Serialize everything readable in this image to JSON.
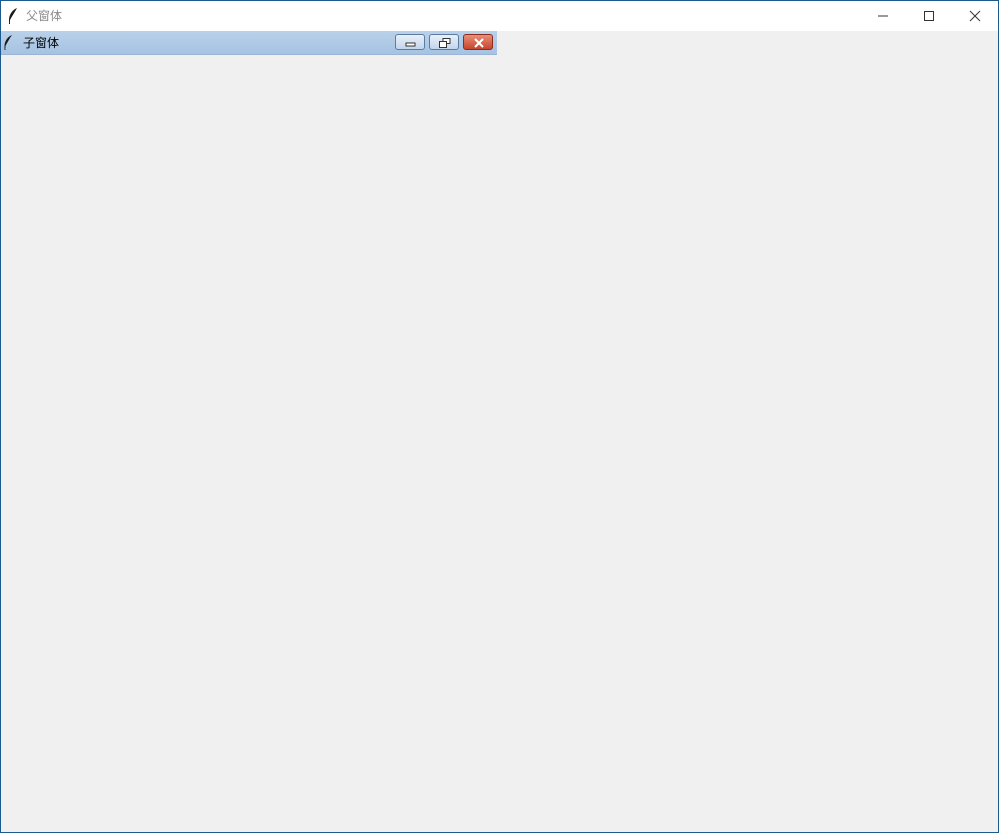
{
  "window": {
    "title": "父窗体",
    "icon": "feather-icon",
    "controls": [
      "minimize",
      "maximize",
      "close"
    ]
  },
  "child_window": {
    "title": "子窗体",
    "icon": "feather-icon",
    "controls": [
      "minimize",
      "restore",
      "close"
    ]
  },
  "colors": {
    "client_background": "#f0f0f0",
    "titlebar_background": "#ffffff",
    "child_titlebar": "#b9d1ea",
    "child_close": "#c6452c"
  }
}
